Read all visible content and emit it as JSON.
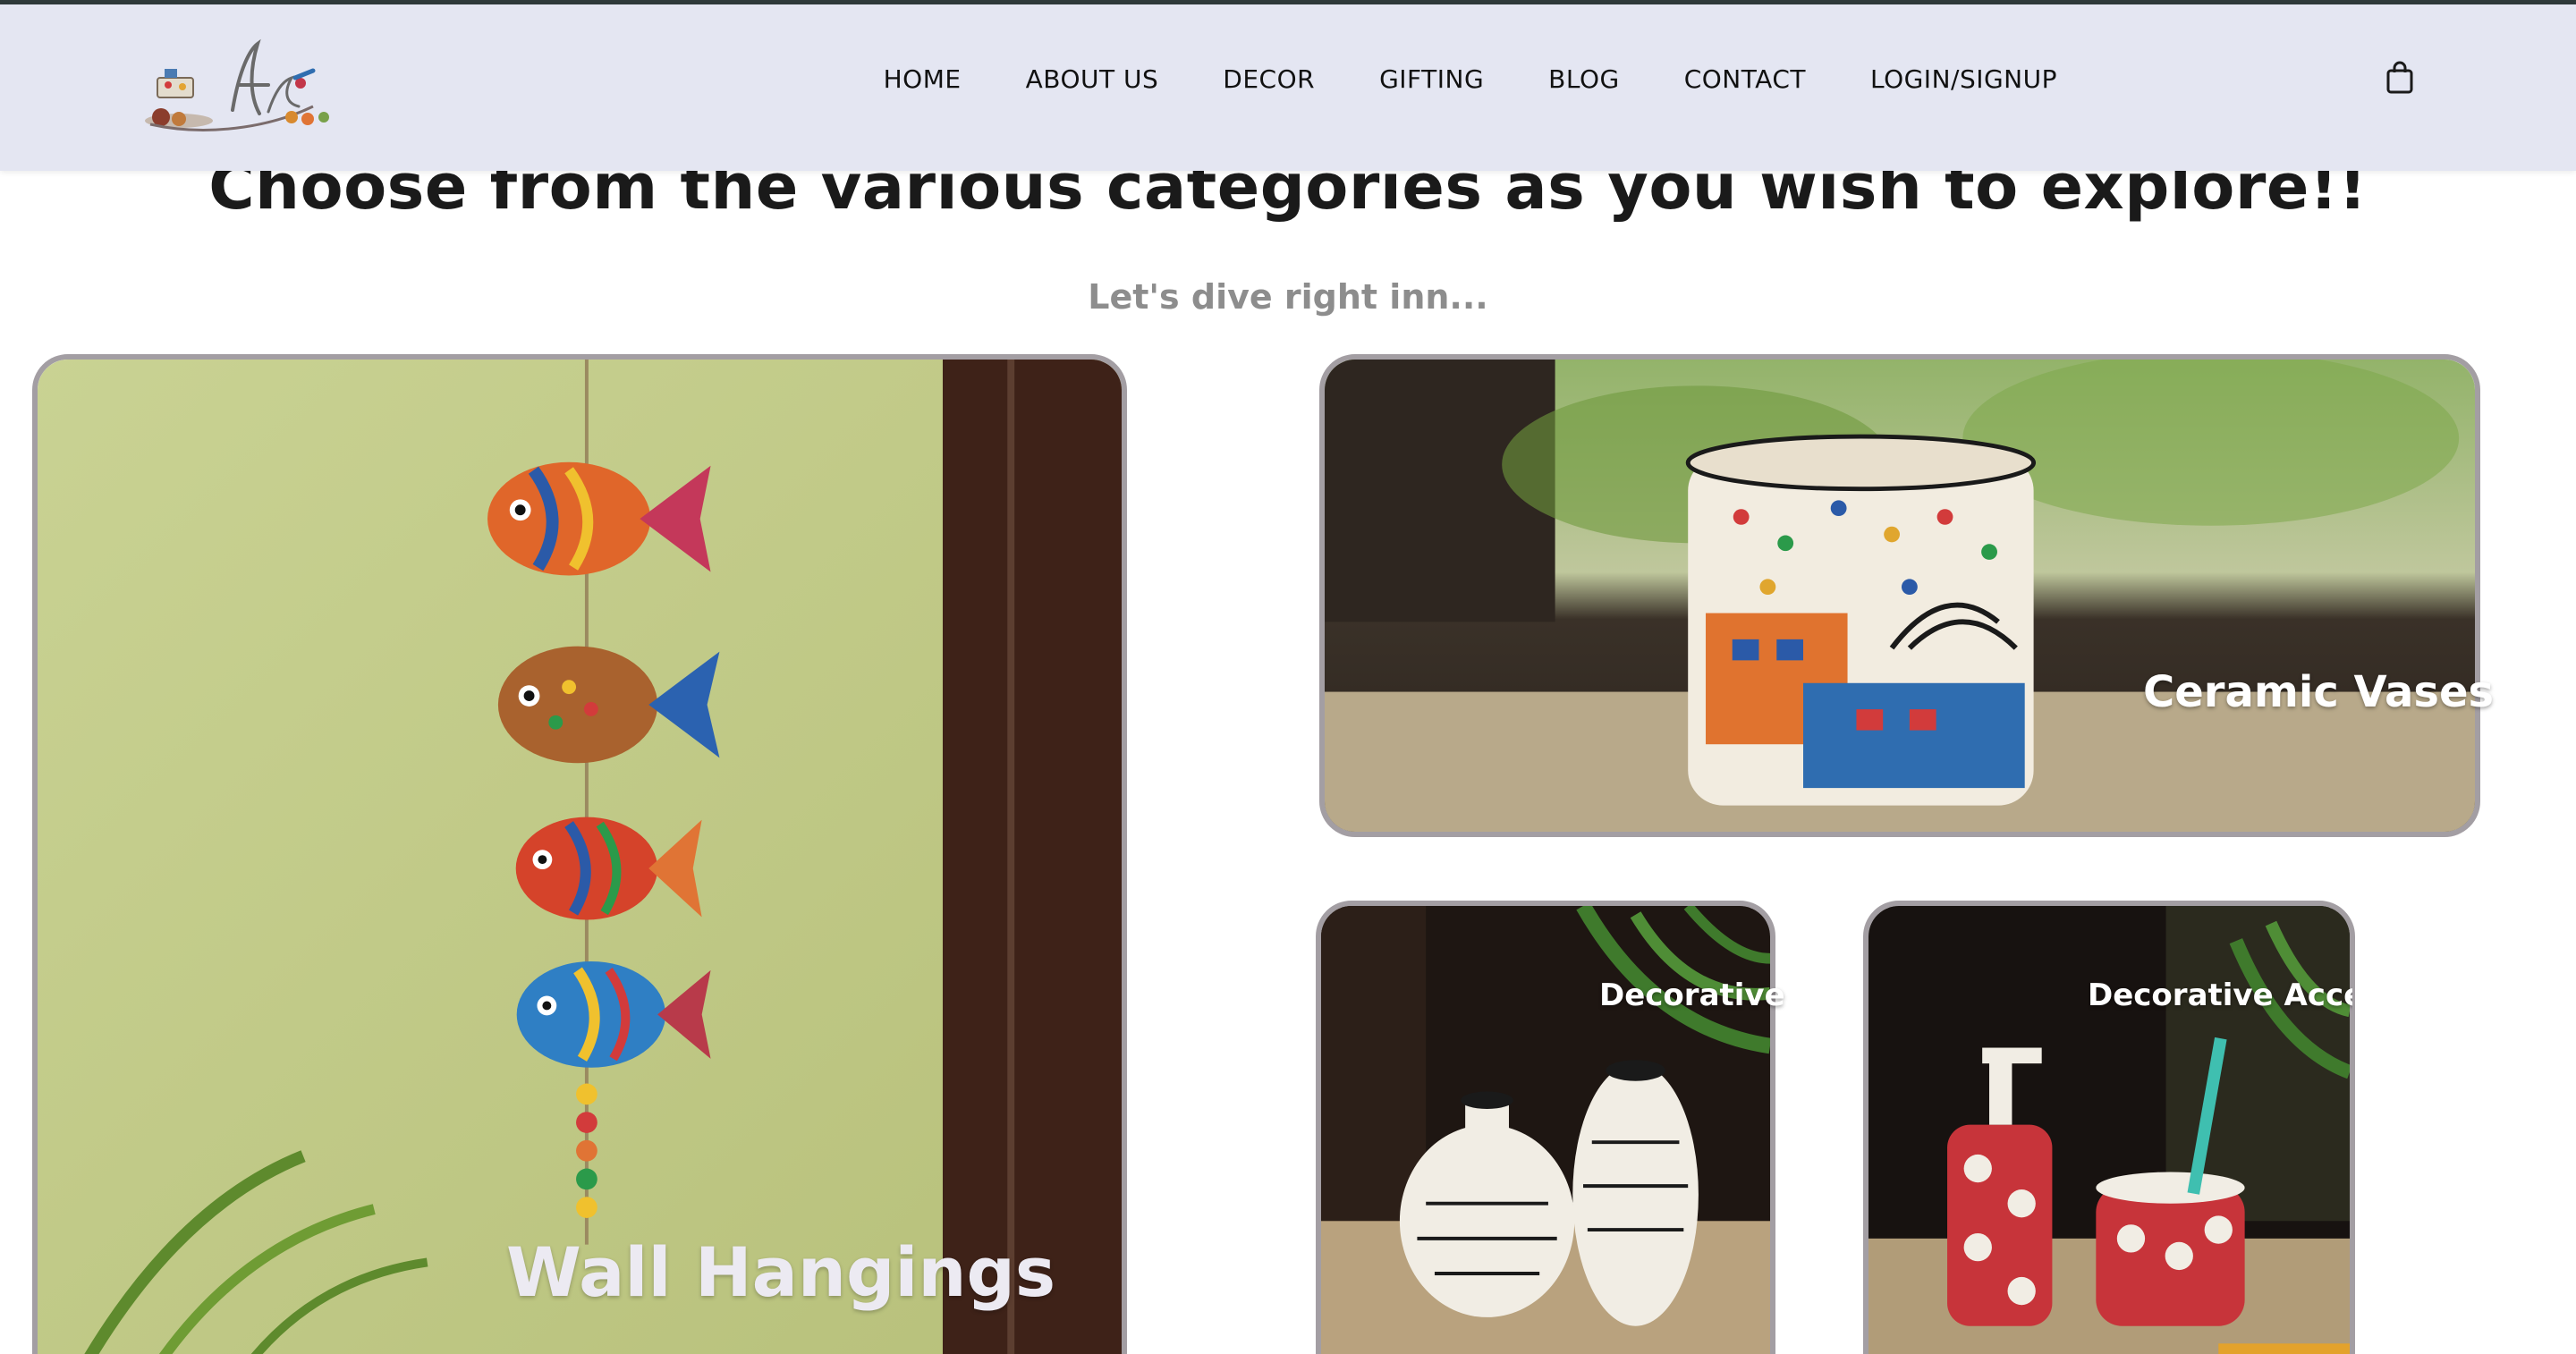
{
  "brand": {
    "logo_icon": "artisan-logo-icon"
  },
  "nav": {
    "items": [
      {
        "label": "HOME"
      },
      {
        "label": "ABOUT US"
      },
      {
        "label": "DECOR"
      },
      {
        "label": "GIFTING"
      },
      {
        "label": "BLOG"
      },
      {
        "label": "CONTACT"
      },
      {
        "label": "LOGIN/SIGNUP"
      }
    ],
    "cart_icon": "shopping-bag-icon"
  },
  "hero": {
    "title": "Choose from the various categories as you wish to explore!!",
    "subtitle": "Let's dive right inn..."
  },
  "categories": [
    {
      "label": "Wall Hangings"
    },
    {
      "label": "Ceramic Vases"
    },
    {
      "label": "Decorative"
    },
    {
      "label": "Decorative Acces"
    }
  ],
  "colors": {
    "header_bg": "#e4e6f2",
    "card_border": "#a39ea3",
    "subtitle_text": "#8d8d8d"
  }
}
